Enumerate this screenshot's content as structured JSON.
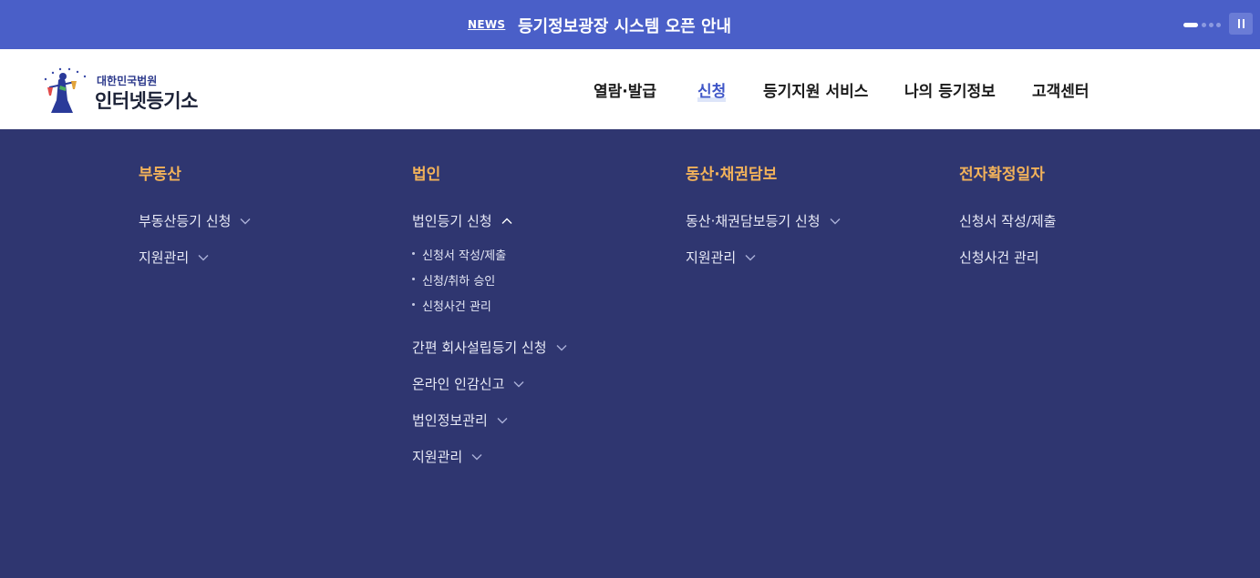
{
  "news": {
    "tag": "NEWS",
    "text": "등기정보광장 시스템 오픈 안내"
  },
  "logo": {
    "sub": "대한민국법원",
    "main": "인터넷등기소",
    "emblem_text": "대 한 민 국 법 원"
  },
  "gnb": [
    "열람·발급",
    "신청",
    "등기지원 서비스",
    "나의 등기정보",
    "고객센터"
  ],
  "gnb_active": "신청",
  "mega_menu": {
    "col1": {
      "title": "부동산",
      "items": [
        "부동산등기 신청",
        "지원관리"
      ]
    },
    "col2": {
      "title": "법인",
      "items": [
        "법인등기 신청",
        "간편 회사설립등기 신청",
        "온라인 인감신고",
        "법인정보관리",
        "지원관리"
      ],
      "subitems": [
        "신청서 작성/제출",
        "신청/취하 승인",
        "신청사건 관리"
      ]
    },
    "col3": {
      "title": "동산·채권담보",
      "items": [
        "동산·채권담보등기 신청",
        "지원관리"
      ]
    },
    "col4": {
      "title": "전자확정일자",
      "items": [
        "신청서 작성/제출",
        "신청사건 관리"
      ]
    }
  },
  "colors": {
    "newsbar": "#4a5fc8",
    "mega_bg": "#2f3670",
    "col_title": "#f2b25a",
    "active_gnb": "#3f56c7"
  },
  "icons": [
    "pause-icon",
    "chevron-down-icon",
    "chevron-up-icon",
    "court-emblem-icon"
  ]
}
